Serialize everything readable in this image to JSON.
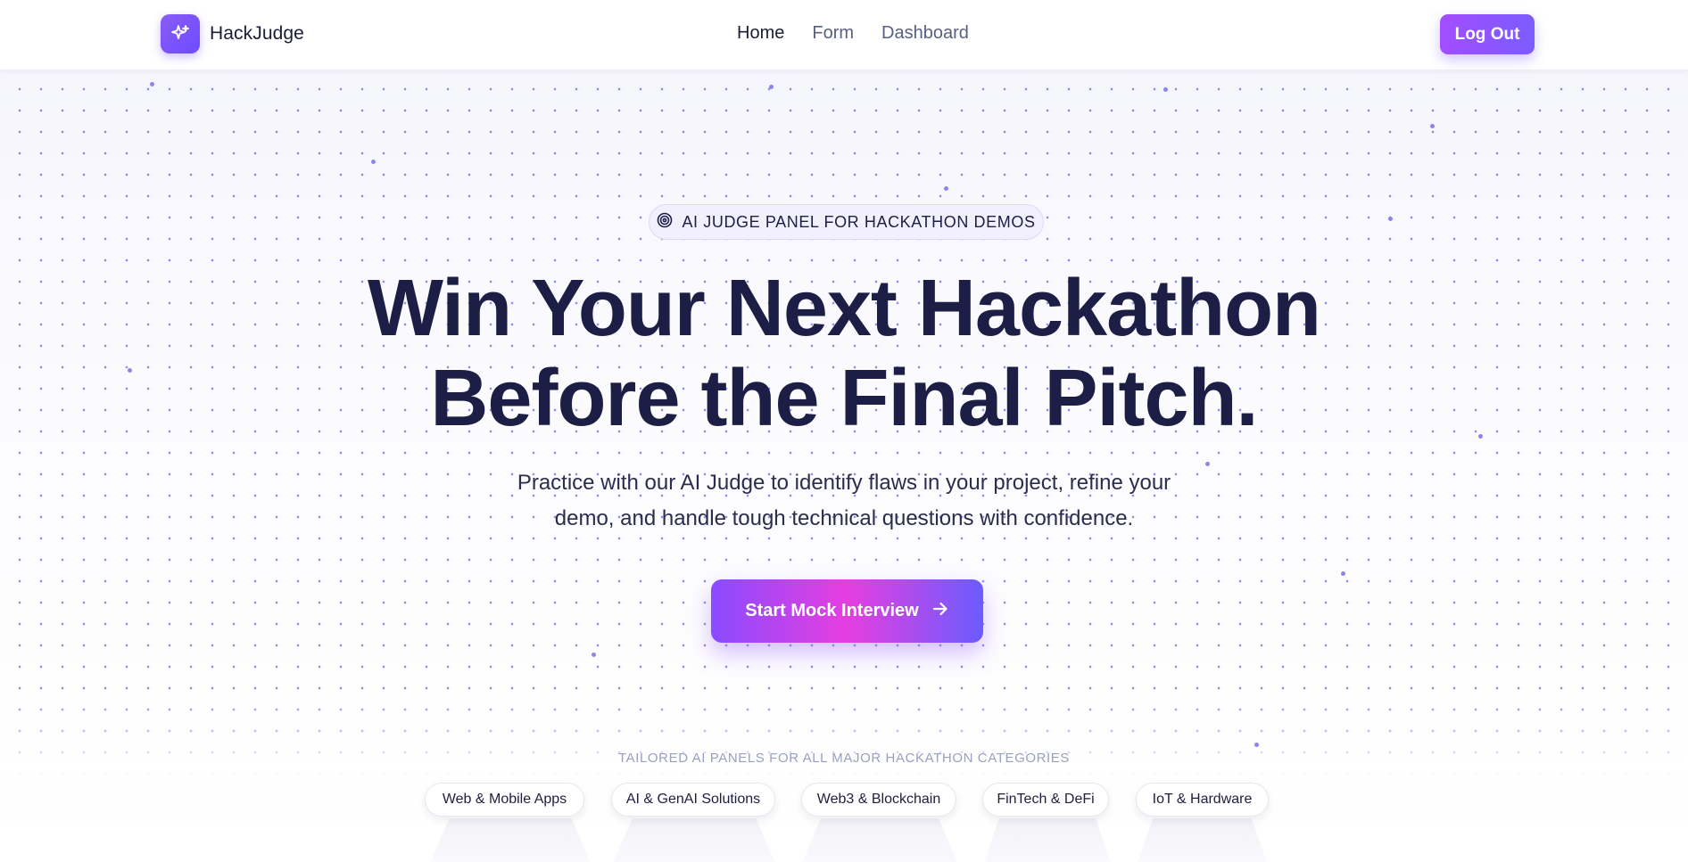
{
  "header": {
    "brand": "HackJudge",
    "nav": [
      {
        "label": "Home",
        "active": true
      },
      {
        "label": "Form",
        "active": false
      },
      {
        "label": "Dashboard",
        "active": false
      }
    ],
    "logout_label": "Log Out",
    "logo_icon": "sparkles-icon"
  },
  "hero": {
    "badge_icon": "target-icon",
    "badge_text": "AI JUDGE PANEL FOR HACKATHON DEMOS",
    "title_line1": "Win Your Next Hackathon",
    "title_line2": "Before the Final Pitch.",
    "subtitle": "Practice with our AI Judge to identify flaws in your project, refine your demo, and handle tough technical questions with confidence.",
    "cta_label": "Start Mock Interview",
    "cta_icon": "arrow-right-icon"
  },
  "categories": {
    "tagline": "TAILORED AI PANELS FOR ALL MAJOR HACKATHON CATEGORIES",
    "items": [
      "Web & Mobile Apps",
      "AI & GenAI Solutions",
      "Web3 & Blockchain",
      "FinTech & DeFi",
      "IoT & Hardware"
    ]
  },
  "colors": {
    "accent": "#7a5cff",
    "accent_pink": "#e63ee0",
    "text_dark": "#1c1e45"
  }
}
